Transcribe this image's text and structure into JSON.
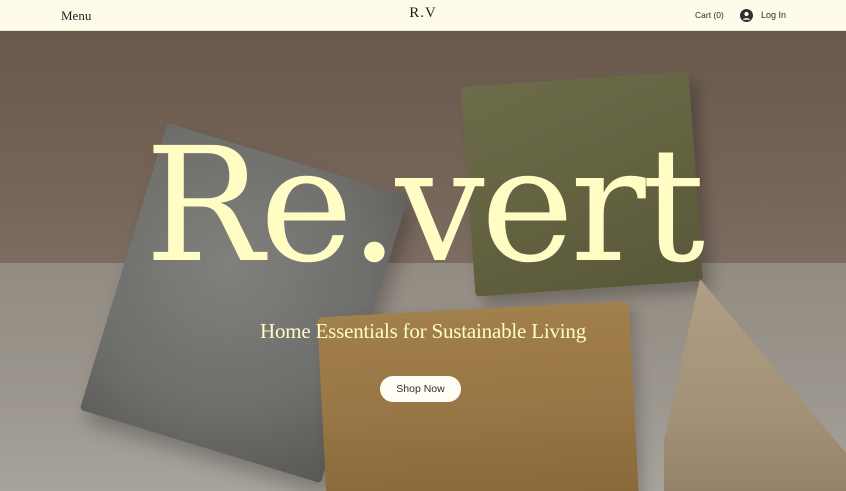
{
  "header": {
    "menu_label": "Menu",
    "logo": "R.V",
    "cart_label": "Cart (0)",
    "login_label": "Log In",
    "login_icon": "user-avatar-icon"
  },
  "hero": {
    "title": "Re.vert",
    "subtitle": "Home Essentials for Sustainable Living",
    "cta_label": "Shop Now"
  },
  "colors": {
    "header_bg": "#fefbea",
    "hero_text": "#fffcc4",
    "button_bg": "#fffdf4"
  }
}
